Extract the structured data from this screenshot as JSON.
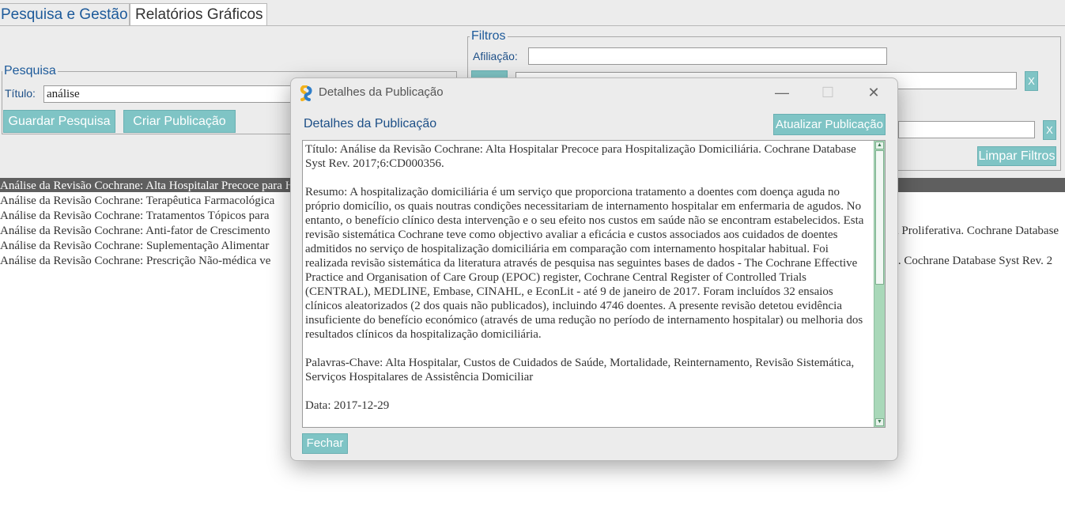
{
  "tabs": {
    "active": "Pesquisa e Gestão",
    "inactive": "Relatórios Gráficos"
  },
  "search": {
    "legend": "Pesquisa",
    "title_label": "Título:",
    "title_value": "análise",
    "save_label": "Guardar Pesquisa",
    "create_label": "Criar Publicação"
  },
  "filters": {
    "legend": "Filtros",
    "affiliation_label": "Afiliação:",
    "affiliation_value": "",
    "clear_x": "X",
    "clear_label": "Limpar Filtros"
  },
  "results": [
    {
      "text": "Análise da Revisão Cochrane: Alta Hospitalar Precoce para Hospitalização Domiciliária. Cochrane Database Syst Rev. 2017;6:CD000356.",
      "tail": ""
    },
    {
      "text": "Análise da Revisão Cochrane: Terapêutica Farmacológica",
      "tail": ""
    },
    {
      "text": "Análise da Revisão Cochrane: Tratamentos Tópicos para",
      "tail": ""
    },
    {
      "text": "Análise da Revisão Cochrane: Anti-fator de Crescimento",
      "tail": "a Proliferativa. Cochrane Database"
    },
    {
      "text": "Análise da Revisão Cochrane: Suplementação Alimentar",
      "tail": ""
    },
    {
      "text": "Análise da Revisão Cochrane: Prescrição Não-médica ve",
      "tail": "s. Cochrane Database Syst Rev. 2"
    }
  ],
  "dialog": {
    "window_title": "Detalhes da Publicação",
    "heading": "Detalhes da Publicação",
    "update_label": "Atualizar Publicação",
    "close_label": "Fechar",
    "minimize": "—",
    "maximize": "☐",
    "close_x": "✕",
    "title_text": "Título: Análise da Revisão Cochrane: Alta Hospitalar Precoce para Hospitalização Domiciliária. Cochrane Database Syst Rev. 2017;6:CD000356.",
    "abstract_text": "Resumo: A hospitalização domiciliária é um serviço que proporciona tratamento a doentes com doença aguda no próprio domicílio, os quais noutras condições necessitariam de internamento hospitalar em enfermaria de agudos. No entanto, o benefício clínico desta intervenção e o seu efeito nos custos em saúde não se encontram estabelecidos. Esta revisão sistemática Cochrane teve como objectivo avaliar a eficácia e custos associados aos cuidados de doentes admitidos no serviço de hospitalização domiciliária em comparação com internamento hospitalar habitual. Foi realizada revisão sistemática da literatura através de pesquisa nas seguintes bases de dados - The Cochrane Effective Practice and Organisation of Care Group (EPOC) register, Cochrane Central Register of Controlled Trials (CENTRAL), MEDLINE, Embase, CINAHL, e EconLit - até 9 de janeiro de 2017. Foram incluídos 32 ensaios clínicos aleatorizados (2 dos quais não publicados), incluindo 4746 doentes. A presente revisão detetou evidência insuficiente do benefício económico (através de uma redução no período de internamento hospitalar) ou melhoria dos resultados clínicos da hospitalização domiciliária.",
    "keywords_text": "Palavras-Chave: Alta Hospitalar, Custos de Cuidados de Saúde, Mortalidade, Reinternamento, Revisão Sistemática, Serviços Hospitalares de Assistência Domiciliar",
    "date_text": "Data: 2017-12-29"
  },
  "colors": {
    "accent_button": "#7fc4c5",
    "link_blue": "#1d5a9a",
    "selected_row": "#5f5f5f"
  }
}
